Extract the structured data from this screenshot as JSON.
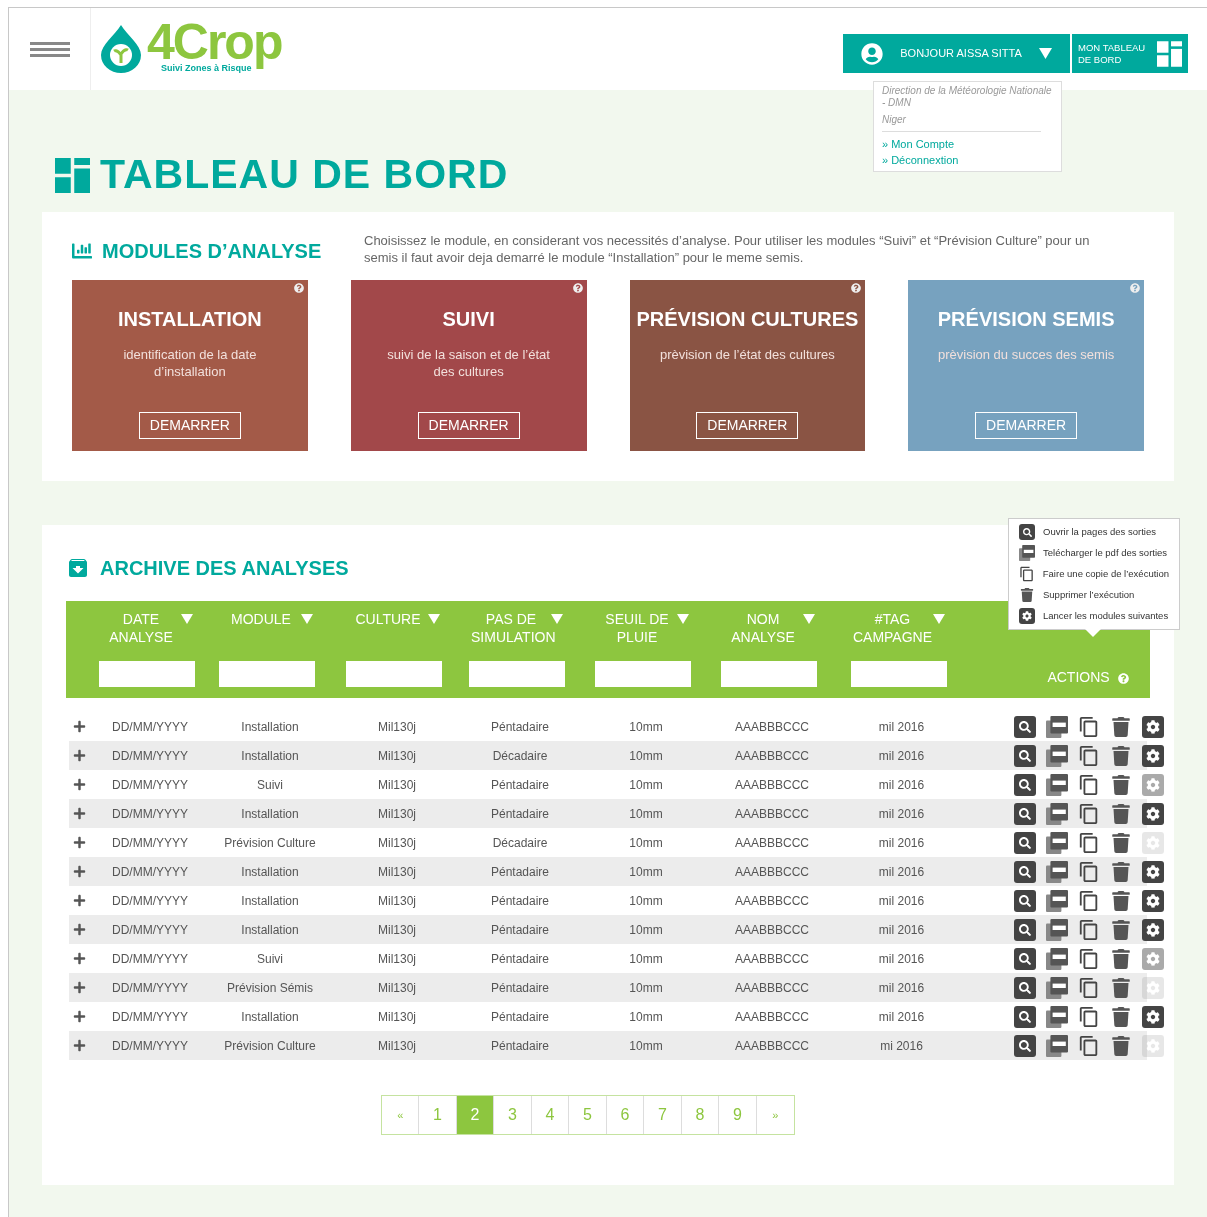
{
  "logo": {
    "name": "4Crop",
    "tagline": "Suivi Zones à Risque"
  },
  "user_menu": {
    "greeting": "BONJOUR AISSA SITTA",
    "expanded": true,
    "organization": "Direction de la Météorologie Nationale -  DMN",
    "country": "Niger",
    "links": [
      "» Mon Compte",
      "» Déconnextion"
    ]
  },
  "dashboard_button": "MON TABLEAU DE BORD",
  "page_title": "TABLEAU DE BORD",
  "modules": {
    "title": "MODULES D’ANALYSE",
    "intro": "Choisissez le module, en considerant vos necessités d’analyse. Pour utiliser les modules “Suivi” et “Prévision Culture” pour un semis il faut avoir deja demarré le module “Installation” pour le meme semis.",
    "cards": [
      {
        "title": "INSTALLATION",
        "description": "identification de la date d’installation",
        "button": "DEMARRER",
        "color": "#a35a48"
      },
      {
        "title": "SUIVI",
        "description": "suivi de la saison et de l’état des cultures",
        "button": "DEMARRER",
        "color": "#a2484a"
      },
      {
        "title": "PRÉVISION CULTURES",
        "description": "prèvision de l’état des cultures",
        "button": "DEMARRER",
        "color": "#8a5444"
      },
      {
        "title": "PRÉVISION SEMIS",
        "description": "prèvision du succes des semis",
        "button": "DEMARRER",
        "color": "#77a2bf"
      }
    ]
  },
  "archive": {
    "title": "ARCHIVE DES ANALYSES",
    "columns": [
      {
        "label": "DATE ANALYSE"
      },
      {
        "label": "MODULE"
      },
      {
        "label": "CULTURE"
      },
      {
        "label": "PAS DE SIMULATION"
      },
      {
        "label": "SEUIL DE PLUIE"
      },
      {
        "label": "NOM ANALYSE"
      },
      {
        "label": "#TAG CAMPAGNE"
      }
    ],
    "actions_label": "ACTIONS",
    "actions_tooltip": [
      {
        "kind": "open",
        "label": "Ouvrir la pages des sorties"
      },
      {
        "kind": "pdf",
        "label": "Telécharger le pdf des sorties"
      },
      {
        "kind": "copy",
        "label": "Faire une copie de l’exécution"
      },
      {
        "kind": "delete",
        "label": "Supprimer l’exécution"
      },
      {
        "kind": "run",
        "label": "Lancer les modules suivantes"
      }
    ],
    "rows": [
      {
        "cells": [
          "DD/MM/YYYY",
          "Installation",
          "Mil130j",
          "Péntadaire",
          "10mm",
          "AAABBBCCC",
          "mil 2016"
        ],
        "run_enabled": true,
        "run_partial": false
      },
      {
        "cells": [
          "DD/MM/YYYY",
          "Installation",
          "Mil130j",
          "Décadaire",
          "10mm",
          "AAABBBCCC",
          "mil 2016"
        ],
        "run_enabled": true,
        "run_partial": false
      },
      {
        "cells": [
          "DD/MM/YYYY",
          "Suivi",
          "Mil130j",
          "Péntadaire",
          "10mm",
          "AAABBBCCC",
          "mil 2016"
        ],
        "run_enabled": true,
        "run_partial": true
      },
      {
        "cells": [
          "DD/MM/YYYY",
          "Installation",
          "Mil130j",
          "Péntadaire",
          "10mm",
          "AAABBBCCC",
          "mil 2016"
        ],
        "run_enabled": true,
        "run_partial": false
      },
      {
        "cells": [
          "DD/MM/YYYY",
          "Prévision Culture",
          "Mil130j",
          "Décadaire",
          "10mm",
          "AAABBBCCC",
          "mil 2016"
        ],
        "run_enabled": false,
        "run_partial": false
      },
      {
        "cells": [
          "DD/MM/YYYY",
          "Installation",
          "Mil130j",
          "Péntadaire",
          "10mm",
          "AAABBBCCC",
          "mil 2016"
        ],
        "run_enabled": true,
        "run_partial": false
      },
      {
        "cells": [
          "DD/MM/YYYY",
          "Installation",
          "Mil130j",
          "Péntadaire",
          "10mm",
          "AAABBBCCC",
          "mil 2016"
        ],
        "run_enabled": true,
        "run_partial": false
      },
      {
        "cells": [
          "DD/MM/YYYY",
          "Installation",
          "Mil130j",
          "Péntadaire",
          "10mm",
          "AAABBBCCC",
          "mil 2016"
        ],
        "run_enabled": true,
        "run_partial": false
      },
      {
        "cells": [
          "DD/MM/YYYY",
          "Suivi",
          "Mil130j",
          "Péntadaire",
          "10mm",
          "AAABBBCCC",
          "mil 2016"
        ],
        "run_enabled": true,
        "run_partial": true
      },
      {
        "cells": [
          "DD/MM/YYYY",
          "Prévision Sémis",
          "Mil130j",
          "Péntadaire",
          "10mm",
          "AAABBBCCC",
          "mil 2016"
        ],
        "run_enabled": false,
        "run_partial": false
      },
      {
        "cells": [
          "DD/MM/YYYY",
          "Installation",
          "Mil130j",
          "Péntadaire",
          "10mm",
          "AAABBBCCC",
          "mil 2016"
        ],
        "run_enabled": true,
        "run_partial": false
      },
      {
        "cells": [
          "DD/MM/YYYY",
          "Prévision Culture",
          "Mil130j",
          "Péntadaire",
          "10mm",
          "AAABBBCCC",
          "mi 2016"
        ],
        "run_enabled": false,
        "run_partial": false
      }
    ],
    "pagination": {
      "prev": "«",
      "next": "»",
      "pages": [
        {
          "label": "1",
          "selected": false
        },
        {
          "label": "2",
          "selected": true
        },
        {
          "label": "3",
          "selected": false
        },
        {
          "label": "4",
          "selected": false
        },
        {
          "label": "5",
          "selected": false
        },
        {
          "label": "6",
          "selected": false
        },
        {
          "label": "7",
          "selected": false
        },
        {
          "label": "8",
          "selected": false
        },
        {
          "label": "9",
          "selected": false
        }
      ]
    }
  }
}
